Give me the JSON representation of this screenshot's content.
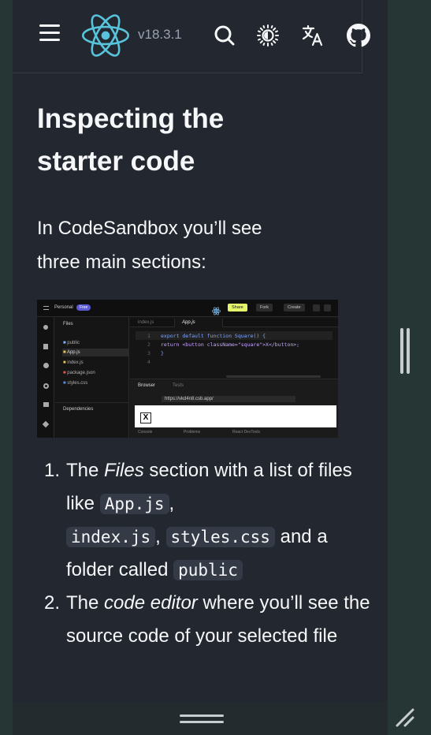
{
  "topbar": {
    "version": "v18.3.1",
    "icons": [
      "menu-icon",
      "react-logo-icon",
      "search-icon",
      "theme-sun-icon",
      "translate-icon",
      "github-icon"
    ]
  },
  "heading": {
    "line1": "Inspecting the",
    "line2": "starter code"
  },
  "intro": {
    "line1": "In CodeSandbox you’ll see",
    "line2": "three main sections:"
  },
  "codesandbox": {
    "workspace": "Personal",
    "plan_badge": "Free",
    "share": "Share",
    "fork": "Fork",
    "create": "Create",
    "files_label": "Files",
    "tabs": [
      "index.js",
      "App.js"
    ],
    "tree": [
      "public",
      "App.js",
      "index.js",
      "package.json",
      "styles.css"
    ],
    "dependencies": "Dependencies",
    "code_lines": [
      {
        "n": "1",
        "text": "export default function Square() {"
      },
      {
        "n": "2",
        "text": "  return <button className=\"square\">X</button>;"
      },
      {
        "n": "3",
        "text": "}"
      },
      {
        "n": "4",
        "text": ""
      }
    ],
    "browser_tab": "Browser",
    "tests_tab": "Tests",
    "url": "https://vkd4n8.csb.app/",
    "preview_button": "X",
    "bottom_tabs": [
      "Console",
      "Problems",
      "React DevTools"
    ]
  },
  "list": {
    "item1": {
      "num": "1.",
      "pre": "The ",
      "em": "Files",
      "mid": " section with a list of files like ",
      "code1": "App.js",
      "sep1": ",",
      "code2": "index.js",
      "sep2": ", ",
      "code3": "styles.css",
      "mid2": " and a folder called ",
      "code4": "public"
    },
    "item2": {
      "num": "2.",
      "pre": "The ",
      "em": "code editor",
      "post": " where you’ll see the source code of your selected file"
    }
  },
  "colors": {
    "page_bg": "#23272f",
    "frame_bg": "#263634",
    "accent": "#58c4dc",
    "text": "#f6f7f9",
    "muted": "#99a1b3"
  }
}
